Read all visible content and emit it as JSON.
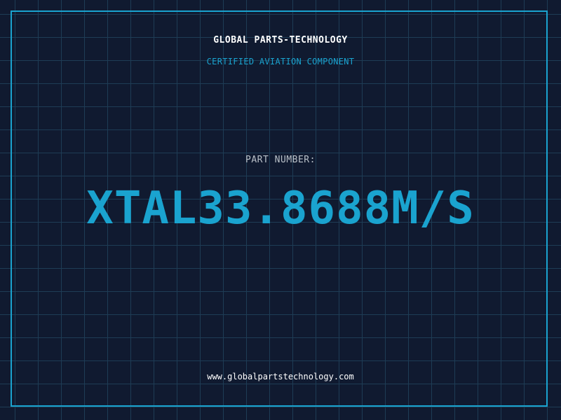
{
  "header": {
    "company": "GLOBAL PARTS-TECHNOLOGY",
    "tagline": "CERTIFIED AVIATION COMPONENT"
  },
  "part": {
    "label": "PART NUMBER:",
    "number": "XTAL33.8688M/S"
  },
  "footer": {
    "url": "www.globalpartstechnology.com"
  },
  "colors": {
    "background": "#101a30",
    "grid": "#1e3c55",
    "accent": "#1aa3cf",
    "text_primary": "#ffffff",
    "text_muted": "#b9c0c8"
  }
}
